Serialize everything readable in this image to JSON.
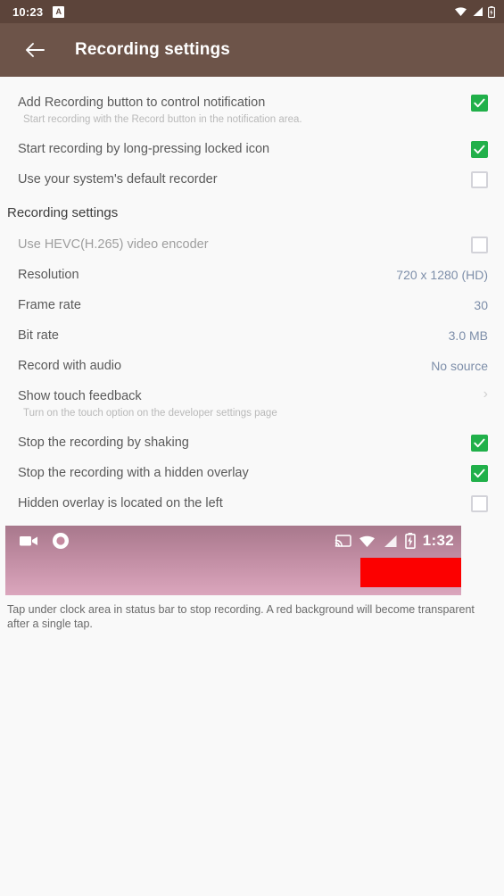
{
  "statusbar": {
    "time": "10:23",
    "badge": "A",
    "icons": [
      "wifi-icon",
      "signal-icon",
      "battery-icon"
    ]
  },
  "appbar": {
    "back_icon": "back-arrow-icon",
    "title": "Recording settings"
  },
  "colors": {
    "statusbar_bg": "#5c443a",
    "appbar_bg": "#6d5449",
    "checkbox_on": "#21b04a",
    "value_text": "#7d8ea9",
    "red_overlay": "#fc0000",
    "page_bg": "#f9f9f9"
  },
  "top_settings": [
    {
      "title": "Add Recording button to control notification",
      "subtitle": "Start recording with the Record button in the notification area.",
      "control": "checkbox",
      "checked": true
    },
    {
      "title": "Start recording by long-pressing locked icon",
      "subtitle": "",
      "control": "checkbox",
      "checked": true
    },
    {
      "title": "Use your system's default recorder",
      "subtitle": "",
      "control": "checkbox",
      "checked": false
    }
  ],
  "section": {
    "header": "Recording settings",
    "items": [
      {
        "title": "Use HEVC(H.265) video encoder",
        "subtitle": "",
        "control": "checkbox",
        "checked": false,
        "dim": true
      },
      {
        "title": "Resolution",
        "subtitle": "",
        "control": "value",
        "value": "720 x 1280 (HD)"
      },
      {
        "title": "Frame rate",
        "subtitle": "",
        "control": "value",
        "value": "30"
      },
      {
        "title": "Bit rate",
        "subtitle": "",
        "control": "value",
        "value": "3.0 MB"
      },
      {
        "title": "Record with audio",
        "subtitle": "",
        "control": "value",
        "value": "No source"
      },
      {
        "title": "Show touch feedback",
        "subtitle": "Turn on the touch option on the developer settings page",
        "control": "chevron",
        "value": "›"
      },
      {
        "title": "Stop the recording by shaking",
        "subtitle": "",
        "control": "checkbox",
        "checked": true
      },
      {
        "title": "Stop the recording with a hidden overlay",
        "subtitle": "",
        "control": "checkbox",
        "checked": true
      },
      {
        "title": "Hidden overlay is located on the left",
        "subtitle": "",
        "control": "checkbox",
        "checked": false
      }
    ]
  },
  "preview": {
    "left_icons": [
      "camcorder-icon",
      "record-dot-icon"
    ],
    "right_icons": [
      "cast-icon",
      "wifi-icon",
      "signal-icon",
      "battery-charging-icon"
    ],
    "time": "1:32"
  },
  "caption": "Tap under clock area in status bar to stop recording. A red background will become transparent after a single tap."
}
